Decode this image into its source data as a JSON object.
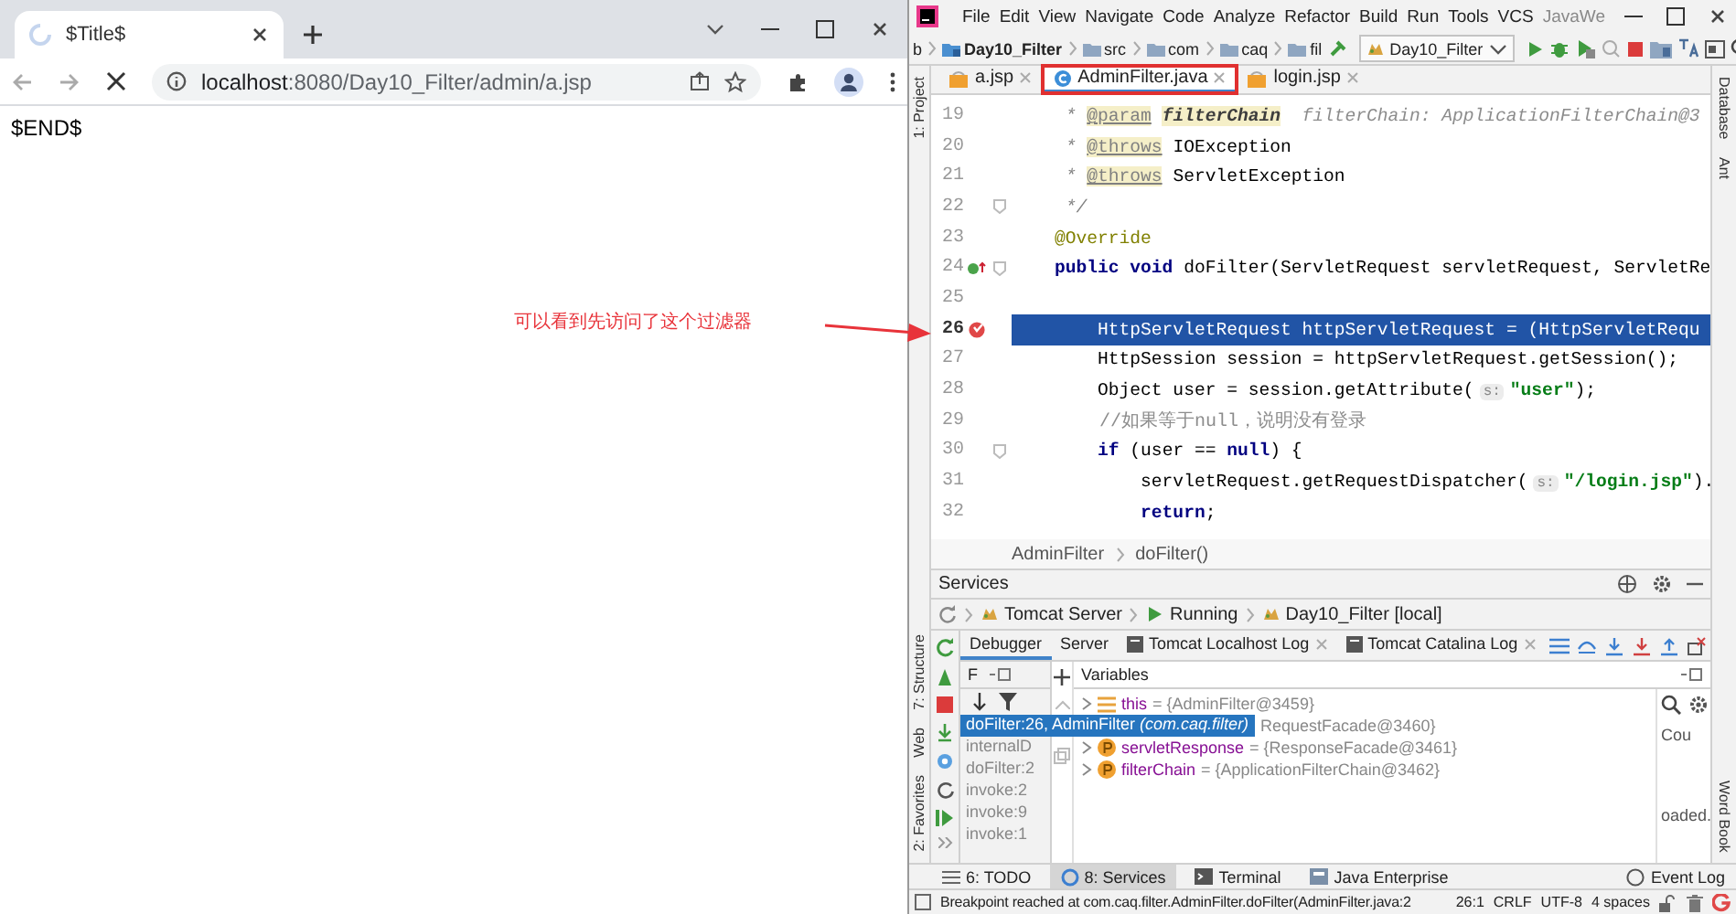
{
  "browser": {
    "tab_title": "$Title$",
    "loading": true,
    "url_host": "localhost",
    "url_path": ":8080/Day10_Filter/admin/a.jsp",
    "page_text": "$END$"
  },
  "annotation": {
    "text": "可以看到先访问了这个过滤器"
  },
  "ide": {
    "menu": [
      "File",
      "Edit",
      "View",
      "Navigate",
      "Code",
      "Analyze",
      "Refactor",
      "Build",
      "Run",
      "Tools",
      "VCS"
    ],
    "title": "JavaWe",
    "nav": [
      {
        "label": "b",
        "kind": "text"
      },
      {
        "label": "Day10_Filter",
        "kind": "module"
      },
      {
        "label": "src",
        "kind": "folder"
      },
      {
        "label": "com",
        "kind": "folder"
      },
      {
        "label": "caq",
        "kind": "folder"
      },
      {
        "label": "fil",
        "kind": "folder"
      }
    ],
    "run_config": "Day10_Filter",
    "left_stripe": [
      {
        "label": "1: Project",
        "kind": "top"
      },
      {
        "label": "7: Structure",
        "kind": "bottom"
      },
      {
        "label": "Web",
        "kind": "bottom"
      },
      {
        "label": "2: Favorites",
        "kind": "bottom"
      }
    ],
    "right_stripe": [
      {
        "label": "Database",
        "kind": "top"
      },
      {
        "label": "Ant",
        "kind": "top"
      },
      {
        "label": "Word Book",
        "kind": "bottom"
      }
    ],
    "editor_tabs": [
      {
        "label": "a.jsp",
        "kind": "jsp",
        "selected": false,
        "outlined": false
      },
      {
        "label": "AdminFilter.java",
        "kind": "class",
        "selected": true,
        "outlined": true
      },
      {
        "label": "login.jsp",
        "kind": "jsp",
        "selected": false,
        "outlined": false
      }
    ],
    "code_lines": [
      {
        "number": "19",
        "current": false,
        "breakpoint": false,
        "override": false,
        "fold": false,
        "tokens": [
          {
            "kind": "doc",
            "text": "     * "
          },
          {
            "kind": "doctag",
            "text": "@param"
          },
          {
            "kind": "docname",
            "text": "filterChain"
          },
          {
            "kind": "hint",
            "text": "filterChain: ApplicationFilterChain@3"
          }
        ]
      },
      {
        "number": "20",
        "current": false,
        "breakpoint": false,
        "override": false,
        "fold": false,
        "tokens": [
          {
            "kind": "doc",
            "text": "     * "
          },
          {
            "kind": "doctag",
            "text": "@throws"
          },
          {
            "kind": "plain",
            "text": " IOException"
          }
        ]
      },
      {
        "number": "21",
        "current": false,
        "breakpoint": false,
        "override": false,
        "fold": false,
        "tokens": [
          {
            "kind": "doc",
            "text": "     * "
          },
          {
            "kind": "doctag",
            "text": "@throws"
          },
          {
            "kind": "plain",
            "text": " ServletException"
          }
        ]
      },
      {
        "number": "22",
        "current": false,
        "breakpoint": false,
        "override": false,
        "fold": true,
        "tokens": [
          {
            "kind": "doc",
            "text": "     */"
          }
        ]
      },
      {
        "number": "23",
        "current": false,
        "breakpoint": false,
        "override": false,
        "fold": false,
        "tokens": [
          {
            "kind": "annot",
            "text": "    @Override"
          }
        ]
      },
      {
        "number": "24",
        "current": false,
        "breakpoint": false,
        "override": true,
        "fold": true,
        "tokens": [
          {
            "kind": "kw",
            "text": "    public void "
          },
          {
            "kind": "plain",
            "text": "doFilter(ServletRequest servletRequest, ServletRe"
          }
        ]
      },
      {
        "number": "25",
        "current": false,
        "breakpoint": false,
        "override": false,
        "fold": false
      },
      {
        "number": "26",
        "current": true,
        "breakpoint": true,
        "override": false,
        "fold": false,
        "tokens": [
          {
            "kind": "plain",
            "text": "        HttpServletRequest httpServletRequest = (HttpServletRequ"
          }
        ]
      },
      {
        "number": "27",
        "current": false,
        "breakpoint": false,
        "override": false,
        "fold": false,
        "tokens": [
          {
            "kind": "plain",
            "text": "        HttpSession session = httpServletRequest.getSession();"
          }
        ]
      },
      {
        "number": "28",
        "current": false,
        "breakpoint": false,
        "override": false,
        "fold": false,
        "tokens": [
          {
            "kind": "plain",
            "text": "        Object user = session.getAttribute("
          },
          {
            "kind": "param_hint",
            "text": "s:"
          },
          {
            "kind": "str",
            "text": "\"user\""
          },
          {
            "kind": "plain",
            "text": ");"
          }
        ]
      },
      {
        "number": "29",
        "current": false,
        "breakpoint": false,
        "override": false,
        "fold": false,
        "tokens": [
          {
            "kind": "comment",
            "text": "        //如果等于null，说明没有登录"
          }
        ]
      },
      {
        "number": "30",
        "current": false,
        "breakpoint": false,
        "override": false,
        "fold": true,
        "tokens": [
          {
            "kind": "kw",
            "text": "        if"
          },
          {
            "kind": "plain",
            "text": " (user == "
          },
          {
            "kind": "kw",
            "text": "null"
          },
          {
            "kind": "plain",
            "text": ") {"
          }
        ]
      },
      {
        "number": "31",
        "current": false,
        "breakpoint": false,
        "override": false,
        "fold": false,
        "tokens": [
          {
            "kind": "plain",
            "text": "            servletRequest.getRequestDispatcher("
          },
          {
            "kind": "param_hint",
            "text": "s:"
          },
          {
            "kind": "str",
            "text": "\"/login.jsp\""
          },
          {
            "kind": "plain",
            "text": ")."
          }
        ]
      },
      {
        "number": "32",
        "current": false,
        "breakpoint": false,
        "override": false,
        "fold": false,
        "tokens": [
          {
            "kind": "kw",
            "text": "            return"
          },
          {
            "kind": "plain",
            "text": ";"
          }
        ]
      }
    ],
    "breadcrumb": [
      "AdminFilter",
      "doFilter()"
    ],
    "services": {
      "title": "Services",
      "tree": [
        {
          "label": "Tomcat Server",
          "kind": "server"
        },
        {
          "label": "Running",
          "kind": "running"
        },
        {
          "label": "Day10_Filter [local]",
          "kind": "artifact"
        }
      ],
      "tabs": [
        {
          "label": "Debugger",
          "selected": true,
          "closable": false
        },
        {
          "label": "Server",
          "selected": false,
          "closable": false
        },
        {
          "label": "Tomcat Localhost Log",
          "selected": false,
          "closable": true
        },
        {
          "label": "Tomcat Catalina Log",
          "selected": false,
          "closable": true
        }
      ],
      "frames_header": "F",
      "variables_header": "Variables",
      "frames": [
        {
          "text": "doFilter:26, AdminFilter *(com.caq.filter)*",
          "selected": true
        },
        {
          "text": "internalD",
          "selected": false
        },
        {
          "text": "doFilter:2",
          "selected": false
        },
        {
          "text": "invoke:2",
          "selected": false
        },
        {
          "text": "invoke:9",
          "selected": false
        },
        {
          "text": "invoke:1",
          "selected": false
        }
      ],
      "variables": [
        {
          "kind": "field",
          "name": "this",
          "value": "= {AdminFilter@3459}"
        },
        {
          "kind": "covered",
          "value": "RequestFacade@3460}"
        },
        {
          "kind": "param",
          "name": "servletResponse",
          "value": "= {ResponseFacade@3461}"
        },
        {
          "kind": "param",
          "name": "filterChain",
          "value": "= {ApplicationFilterChain@3462}"
        }
      ],
      "side_texts": [
        "Cou",
        "oaded."
      ]
    },
    "bottom_tabs": [
      {
        "label": "6: TODO",
        "selected": false
      },
      {
        "label": "8: Services",
        "selected": true
      },
      {
        "label": "Terminal",
        "selected": false
      },
      {
        "label": "Java Enterprise",
        "selected": false
      }
    ],
    "event_log": "Event Log",
    "status_bar": {
      "message": "Breakpoint reached at com.caq.filter.AdminFilter.doFilter(AdminFilter.java:2",
      "items": [
        "26:1",
        "CRLF",
        "UTF-8",
        "4 spaces"
      ]
    }
  }
}
